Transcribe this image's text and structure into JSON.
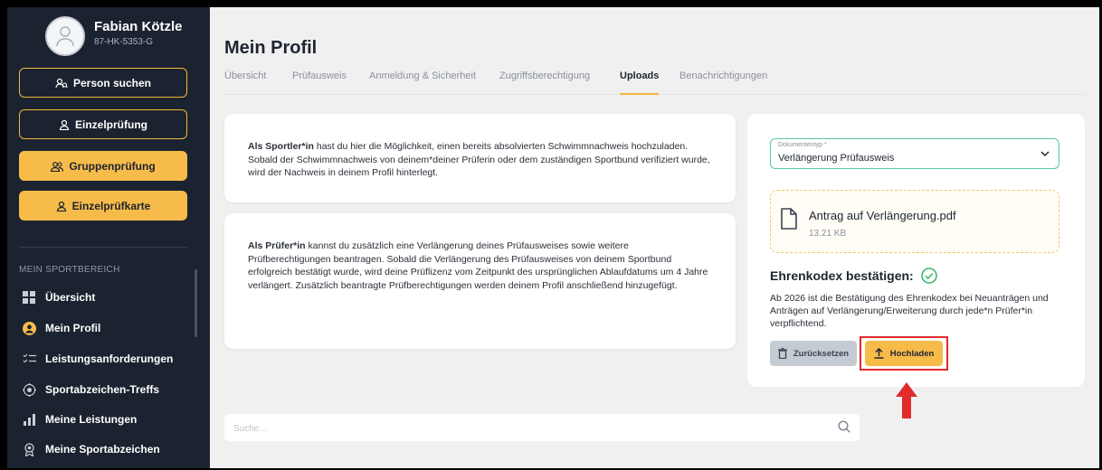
{
  "user": {
    "name": "Fabian Kötzle",
    "id": "87-HK-5353-G"
  },
  "sidebar": {
    "buttons": [
      {
        "label": "Person suchen",
        "style": "outline",
        "icon": "people-search-icon"
      },
      {
        "label": "Einzelprüfung",
        "style": "outline",
        "icon": "person-icon"
      },
      {
        "label": "Gruppenprüfung",
        "style": "filled",
        "icon": "group-icon"
      },
      {
        "label": "Einzelprüfkarte",
        "style": "filled",
        "icon": "person-card-icon"
      }
    ],
    "section_label": "MEIN SPORTBEREICH",
    "nav": [
      {
        "label": "Übersicht",
        "icon": "grid-icon"
      },
      {
        "label": "Mein Profil",
        "icon": "user-circle-icon"
      },
      {
        "label": "Leistungsanforderungen",
        "icon": "checklist-icon"
      },
      {
        "label": "Sportabzeichen-Treffs",
        "icon": "target-icon"
      },
      {
        "label": "Meine Leistungen",
        "icon": "bar-chart-icon"
      },
      {
        "label": "Meine Sportabzeichen",
        "icon": "badge-icon"
      }
    ]
  },
  "page": {
    "title": "Mein Profil",
    "tabs": [
      {
        "label": "Übersicht"
      },
      {
        "label": "Prüfausweis"
      },
      {
        "label": "Anmeldung & Sicherheit"
      },
      {
        "label": "Zugriffsberechtigung"
      },
      {
        "label": "Uploads",
        "active": true
      },
      {
        "label": "Benachrichtigungen"
      }
    ],
    "active_tab": "Uploads"
  },
  "info1": {
    "bold": "Als Sportler*in",
    "text": " hast du hier die Möglichkeit, einen bereits absolvierten Schwimmnachweis hochzuladen. Sobald der Schwimmnachweis von deinem*deiner Prüferin oder dem zuständigen Sportbund verifiziert wurde, wird der Nachweis in deinem Profil hinterlegt."
  },
  "info2": {
    "bold": "Als Prüfer*in",
    "text": " kannst du zusätzlich eine Verlängerung deines Prüfausweises sowie weitere Prüfberechtigungen beantragen. Sobald die Verlängerung des Prüfausweises von deinem Sportbund erfolgreich bestätigt wurde, wird deine Prüflizenz vom Zeitpunkt des ursprünglichen Ablaufdatums um 4 Jahre verlängert. Zusätzlich beantragte Prüfberechtigungen werden deinem Profil anschließend hinzugefügt."
  },
  "upload": {
    "doc_type_label": "Dokumententyp *",
    "doc_type_value": "Verlängerung Prüfausweis",
    "file_name": "Antrag auf Verlängerung.pdf",
    "file_size": "13.21 KB",
    "ehrenkodex_title": "Ehrenkodex bestätigen:",
    "ehrenkodex_text": "Ab 2026 ist die Bestätigung des Ehrenkodex bei Neuanträgen und Anträgen auf Verlängerung/Erweiterung durch jede*n Prüfer*in verpflichtend.",
    "reset_label": "Zurücksetzen",
    "upload_label": "Hochladen"
  },
  "search": {
    "placeholder": "Suche..."
  },
  "colors": {
    "sidebar_bg": "#1b2330",
    "accent": "#f7bb4a",
    "success": "#3ab86e",
    "highlight": "#e02c2c",
    "select_border": "#55c8a8"
  }
}
